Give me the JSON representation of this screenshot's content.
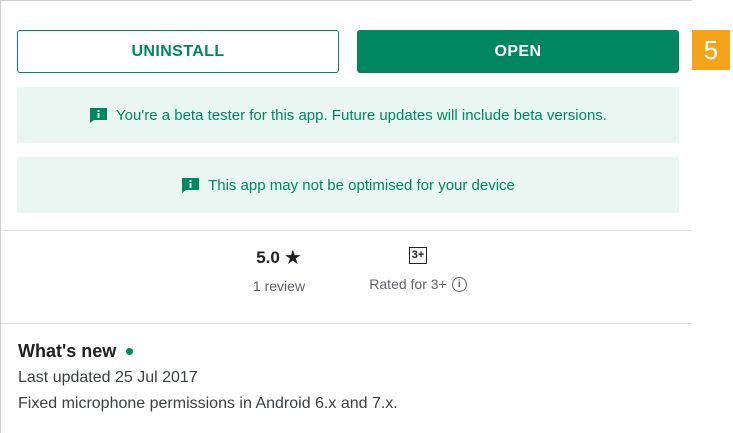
{
  "actions": {
    "uninstall_label": "UNINSTALL",
    "open_label": "OPEN"
  },
  "step_badge": "5",
  "notices": {
    "beta": "You're a beta tester for this app. Future updates will include beta versions.",
    "device": "This app may not be optimised for your device"
  },
  "stats": {
    "rating_value": "5.0",
    "rating_star": "★",
    "review_count": "1 review",
    "age_badge": "3+",
    "rated_for": "Rated for 3+",
    "rated_help_glyph": "i"
  },
  "whats_new": {
    "title": "What's new",
    "last_updated": "Last updated 25 Jul 2017",
    "notes": "Fixed microphone permissions in Android 6.x and 7.x."
  },
  "colors": {
    "accent": "#01875f",
    "notice_bg": "#e9f6f2",
    "badge": "#f5a31a"
  },
  "icons": {
    "notice": "info-message-icon",
    "star": "star-icon",
    "help": "info-circle-icon"
  }
}
